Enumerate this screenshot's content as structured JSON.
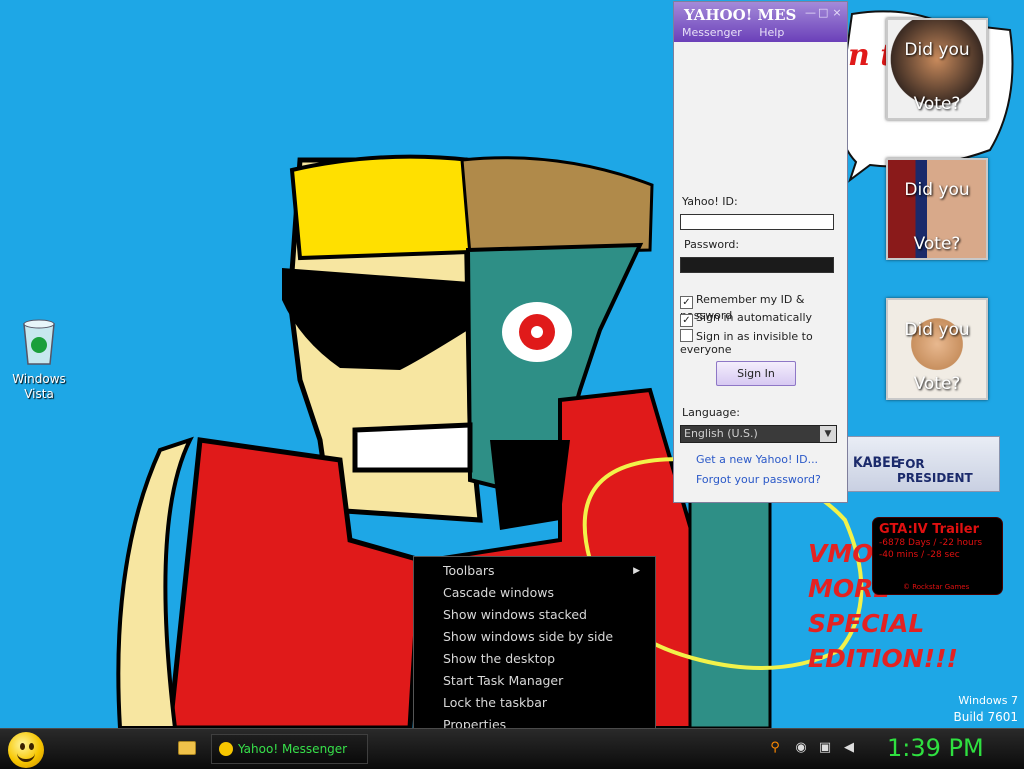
{
  "desktop": {
    "icons": [
      {
        "label_line1": "Windows",
        "label_line2": "Vista"
      }
    ],
    "speech_bubble_text": "n t",
    "graffiti": [
      "VMOD",
      "MORE",
      "SPECIAL",
      "EDITION!!!"
    ]
  },
  "gadgets": {
    "vote": [
      {
        "line1": "Did you",
        "line2": "Vote?"
      },
      {
        "line1": "Did you",
        "line2": "Vote?"
      },
      {
        "line1": "Did you",
        "line2": "Vote?"
      }
    ],
    "banner": {
      "name": "KABEE",
      "subtitle": "FOR PRESIDENT"
    },
    "gta": {
      "title": "GTA:IV Trailer",
      "countdown_line1": "-6878 Days / -22 hours",
      "countdown_line2": "-40 mins / -28 sec",
      "credit": "© Rockstar Games"
    }
  },
  "watermark": {
    "os": "Windows 7",
    "build": "Build 7601"
  },
  "yahoo": {
    "brand": "YAHOO! MES",
    "menu": [
      "Messenger",
      "Help"
    ],
    "id_label": "Yahoo! ID:",
    "id_value": "",
    "password_label": "Password:",
    "checkboxes": [
      {
        "label": "Remember my ID & password",
        "checked": true
      },
      {
        "label": "Sign in automatically",
        "checked": true
      },
      {
        "label": "Sign in as invisible to everyone",
        "checked": false
      }
    ],
    "signin_label": "Sign In",
    "language_label": "Language:",
    "language_value": "English (U.S.)",
    "links": [
      "Get a new Yahoo! ID...",
      "Forgot your password?"
    ],
    "title_buttons": {
      "minimize": "—",
      "maximize": "□",
      "close": "×"
    }
  },
  "context_menu": {
    "items": [
      {
        "label": "Toolbars",
        "submenu": true
      },
      {
        "label": "Cascade windows"
      },
      {
        "label": "Show windows stacked"
      },
      {
        "label": "Show windows side by side"
      },
      {
        "label": "Show the desktop"
      },
      {
        "label": "Start Task Manager"
      },
      {
        "label": "Lock the taskbar"
      },
      {
        "label": "Properties"
      }
    ],
    "submenu_arrow": "▶"
  },
  "taskbar": {
    "task_label": "Yahoo! Messenger",
    "clock": "1:39 PM",
    "tray_icons": [
      "search-icon",
      "messenger-status-icon",
      "network-icon",
      "volume-icon"
    ],
    "clock_color": "#2fe040"
  },
  "colors": {
    "desktop_bg": "#1ea7e6",
    "yahoo_purple": "#6b40b9"
  }
}
